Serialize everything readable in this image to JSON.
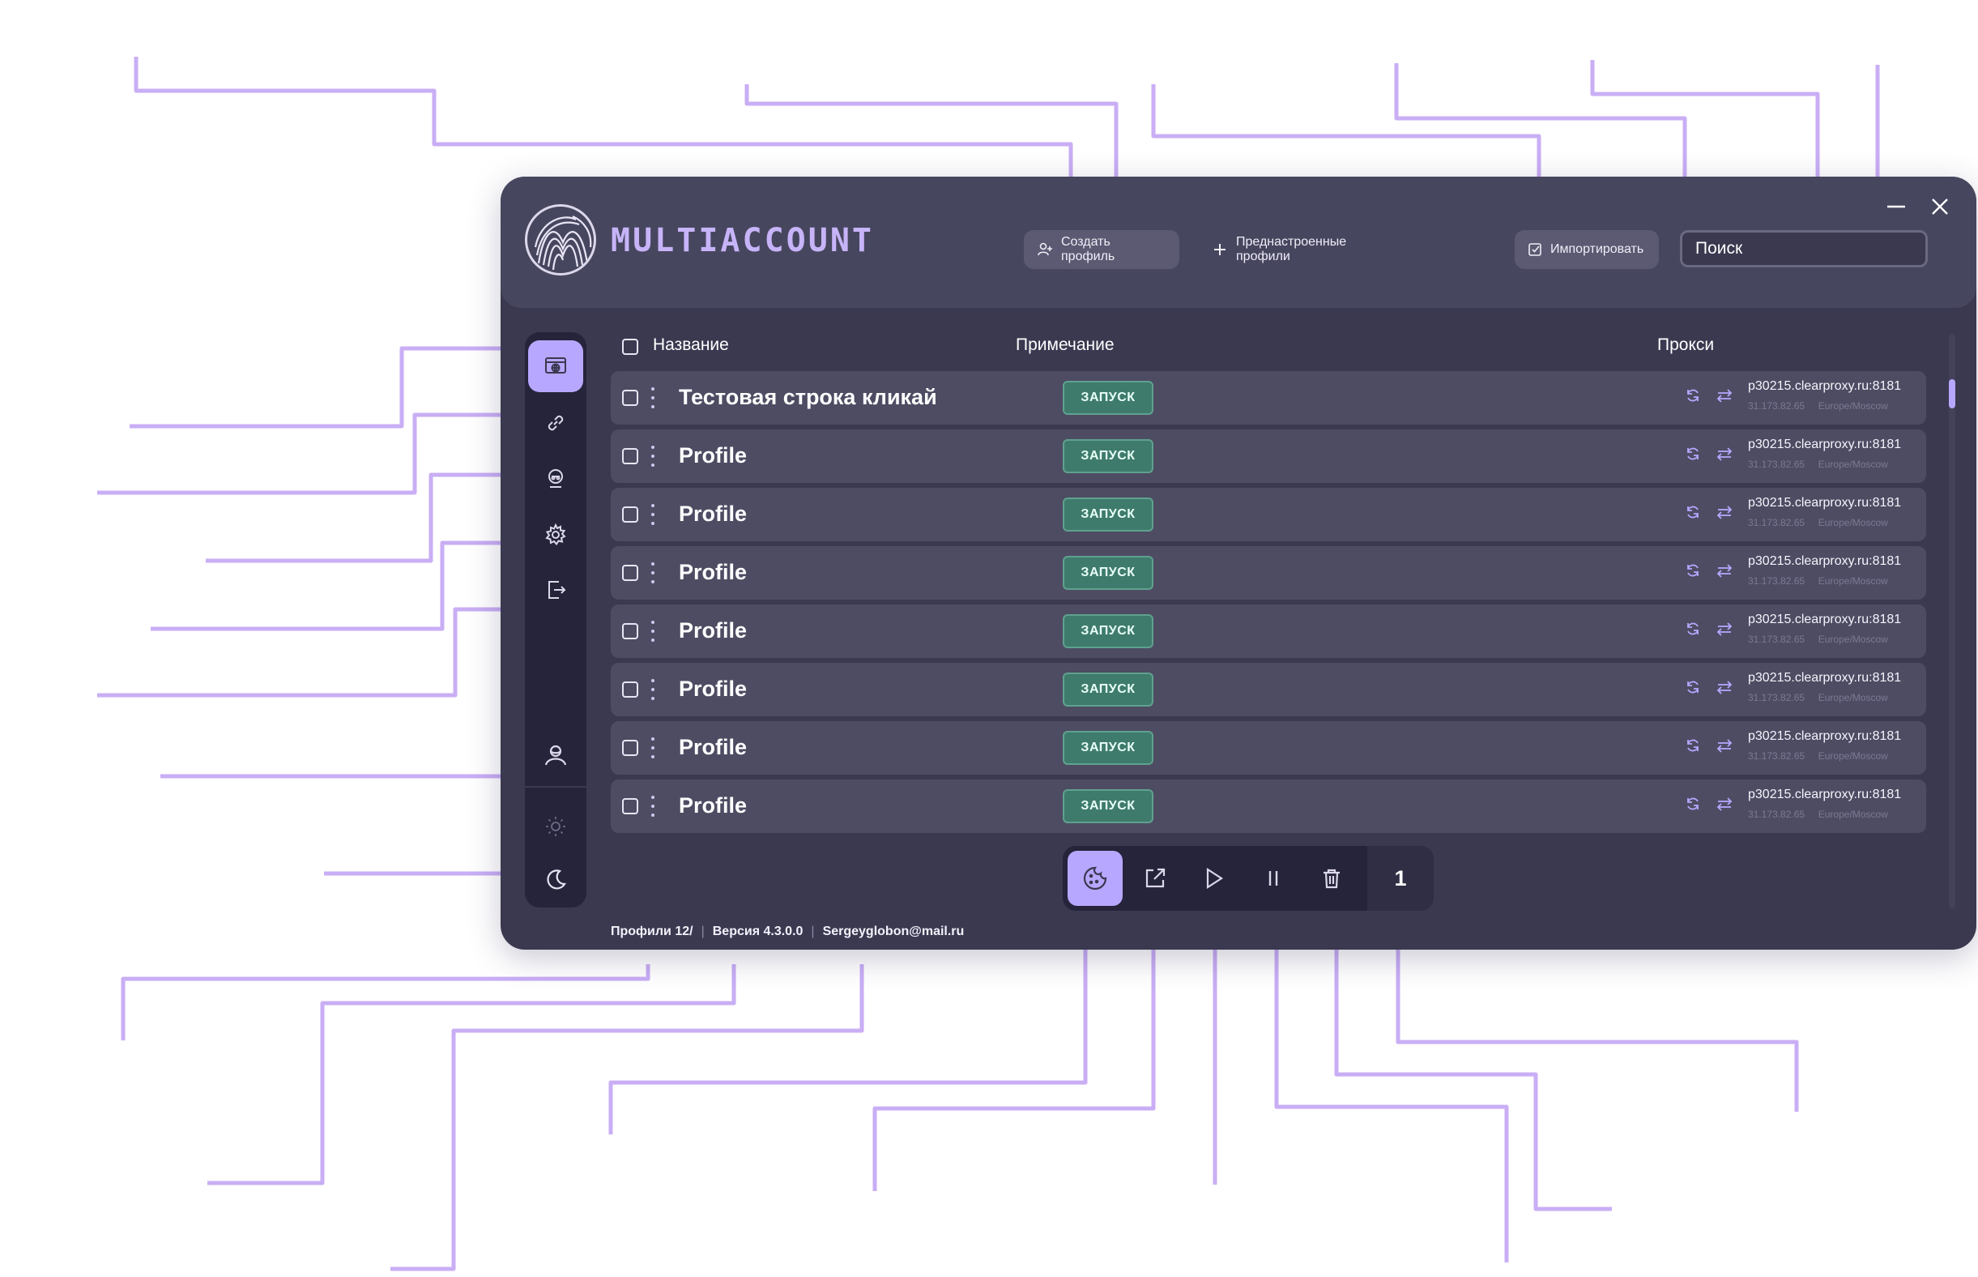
{
  "app": {
    "logo_text": "MULTIACCOUNT"
  },
  "header": {
    "create_profile_label": "Создать профиль",
    "presets_label": "Преднастроенные профили",
    "import_label": "Импортировать",
    "search_placeholder": "Поиск"
  },
  "sidebar": {
    "items": [
      {
        "icon": "profiles-icon",
        "active": true
      },
      {
        "icon": "link-icon",
        "active": false
      },
      {
        "icon": "spy-icon",
        "active": false
      },
      {
        "icon": "gear-icon",
        "active": false
      },
      {
        "icon": "logout-icon",
        "active": false
      },
      {
        "icon": "user-icon",
        "active": false
      },
      {
        "icon": "sun-icon",
        "active": false
      },
      {
        "icon": "moon-icon",
        "active": false
      }
    ]
  },
  "table": {
    "columns": {
      "name": "Название",
      "note": "Примечание",
      "proxy": "Прокси"
    },
    "launch_label": "ЗАПУСК",
    "rows": [
      {
        "name": "Тестовая строка кликай",
        "proxy": "p30215.clearproxy.ru:8181",
        "ip": "31.173.82.65",
        "tz": "Europe/Moscow"
      },
      {
        "name": "Profile",
        "proxy": "p30215.clearproxy.ru:8181",
        "ip": "31.173.82.65",
        "tz": "Europe/Moscow"
      },
      {
        "name": "Profile",
        "proxy": "p30215.clearproxy.ru:8181",
        "ip": "31.173.82.65",
        "tz": "Europe/Moscow"
      },
      {
        "name": "Profile",
        "proxy": "p30215.clearproxy.ru:8181",
        "ip": "31.173.82.65",
        "tz": "Europe/Moscow"
      },
      {
        "name": "Profile",
        "proxy": "p30215.clearproxy.ru:8181",
        "ip": "31.173.82.65",
        "tz": "Europe/Moscow"
      },
      {
        "name": "Profile",
        "proxy": "p30215.clearproxy.ru:8181",
        "ip": "31.173.82.65",
        "tz": "Europe/Moscow"
      },
      {
        "name": "Profile",
        "proxy": "p30215.clearproxy.ru:8181",
        "ip": "31.173.82.65",
        "tz": "Europe/Moscow"
      },
      {
        "name": "Profile",
        "proxy": "p30215.clearproxy.ru:8181",
        "ip": "31.173.82.65",
        "tz": "Europe/Moscow"
      }
    ]
  },
  "toolbar": {
    "selected_count": "1"
  },
  "footer": {
    "profiles": "Профили 12/",
    "version": "Версия 4.3.0.0",
    "email": "Sergeyglobon@mail.ru"
  },
  "colors": {
    "accent": "#b8a7ff",
    "window_bg": "#3a3950",
    "header_bg": "#47465f",
    "row_bg": "#4d4c63",
    "launch_bg": "#3f7b6c",
    "callout_line": "#c9aef5"
  }
}
